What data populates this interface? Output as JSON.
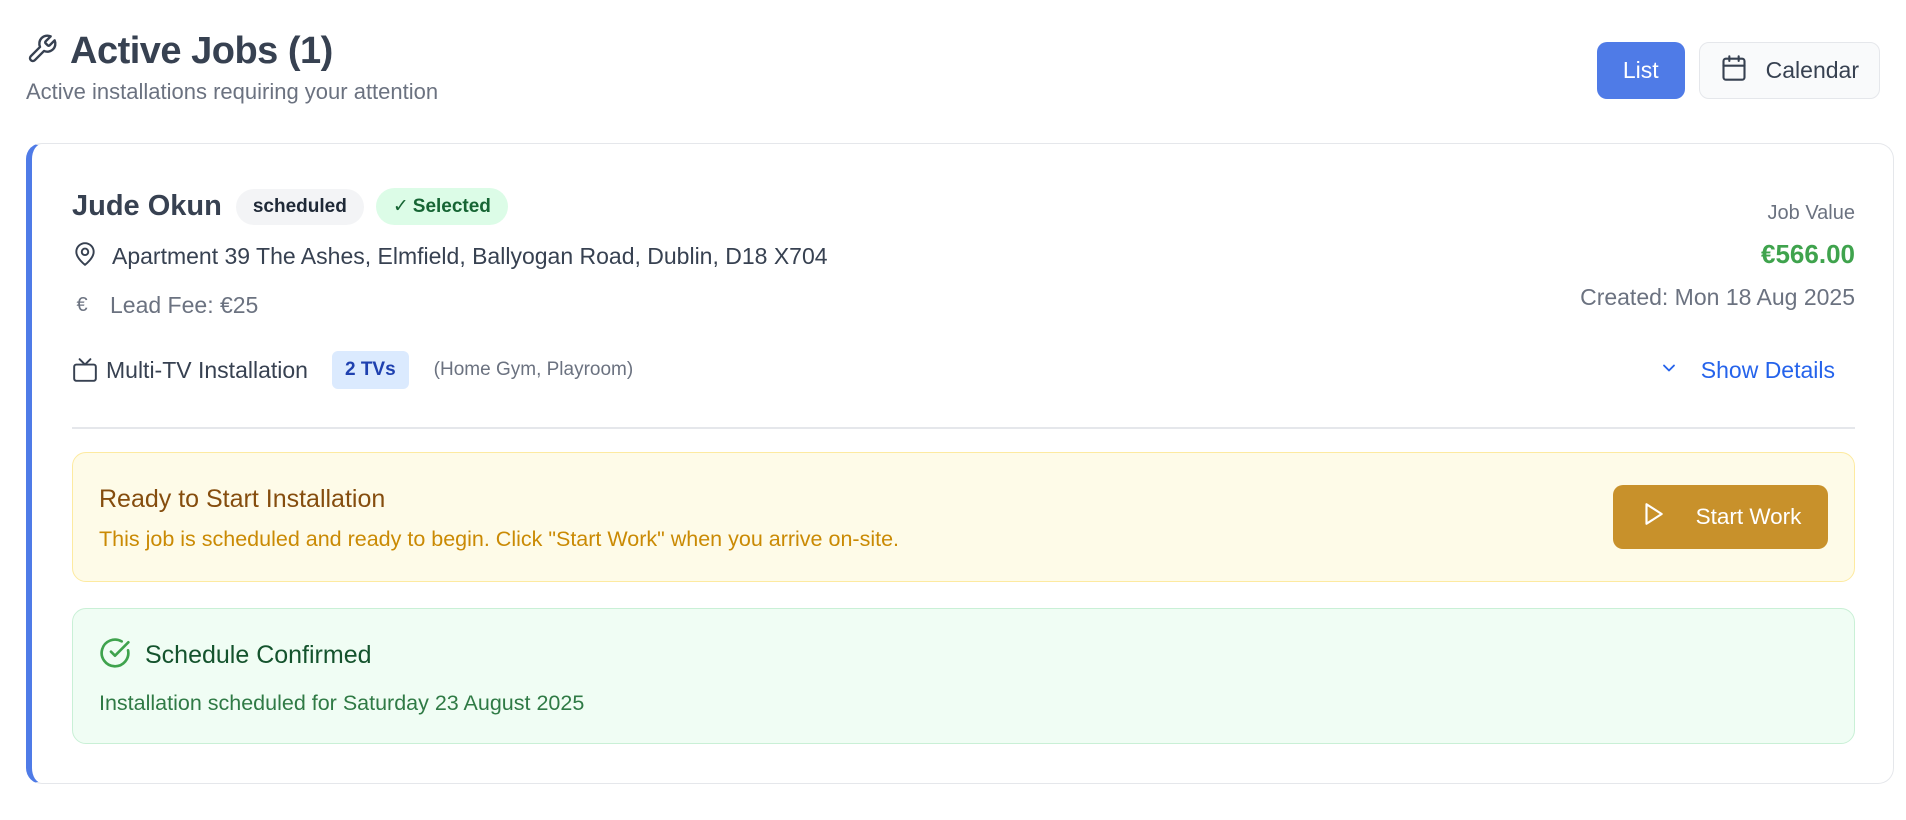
{
  "header": {
    "title": "Active Jobs (1)",
    "subtitle": "Active installations requiring your attention",
    "icon": "wrench-icon"
  },
  "view_toggle": {
    "list_label": "List",
    "calendar_label": "Calendar",
    "active": "List"
  },
  "job": {
    "client_name": "Jude Okun",
    "status_badge": "scheduled",
    "selected_badge": "Selected",
    "address": "Apartment 39 The Ashes, Elmfield, Ballyogan Road, Dublin, D18 X704",
    "lead_fee": "Lead Fee: €25",
    "value_label": "Job Value",
    "value_amount": "€566.00",
    "created": "Created: Mon 18 Aug 2025",
    "service": "Multi-TV Installation",
    "tv_count": "2 TVs",
    "rooms": "(Home Gym, Playroom)",
    "show_details": "Show Details"
  },
  "ready": {
    "title": "Ready to Start Installation",
    "message": "This job is scheduled and ready to begin. Click \"Start Work\" when you arrive on-site.",
    "button": "Start Work"
  },
  "schedule": {
    "title": "Schedule Confirmed",
    "text": "Installation scheduled for Saturday 23 August 2025"
  },
  "colors": {
    "accent": "#4f7be7",
    "value_green": "#3fa34d",
    "start_button": "#c8912b",
    "ready_bg": "#fefbe8",
    "schedule_bg": "#f0fdf4"
  }
}
